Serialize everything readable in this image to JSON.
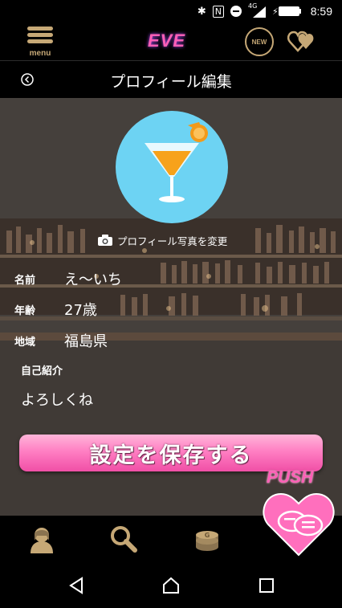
{
  "status_bar": {
    "time": "8:59",
    "network": "4G"
  },
  "header": {
    "menu_label": "menu",
    "logo_text": "EVE",
    "new_badge": "NEW"
  },
  "page": {
    "title": "プロフィール編集"
  },
  "profile": {
    "change_photo_label": "プロフィール写真を変更",
    "fields": [
      {
        "label": "名前",
        "value": "え〜いち"
      },
      {
        "label": "年齢",
        "value": "27歳"
      },
      {
        "label": "地域",
        "value": "福島県"
      }
    ],
    "bio_label": "自己紹介",
    "bio_value": "よろしくね"
  },
  "save_button_label": "設定を保存する",
  "push_label": "PUSH",
  "colors": {
    "accent_gold": "#c6a876",
    "accent_pink": "#ff5fb6",
    "avatar_bg": "#6dd3f3"
  },
  "icons": [
    "menu-icon",
    "new-icon",
    "favorites-icon",
    "back-icon",
    "camera-icon",
    "profile-tab-icon",
    "search-tab-icon",
    "points-tab-icon",
    "push-chat-icon",
    "nav-back-icon",
    "nav-home-icon",
    "nav-recents-icon"
  ]
}
